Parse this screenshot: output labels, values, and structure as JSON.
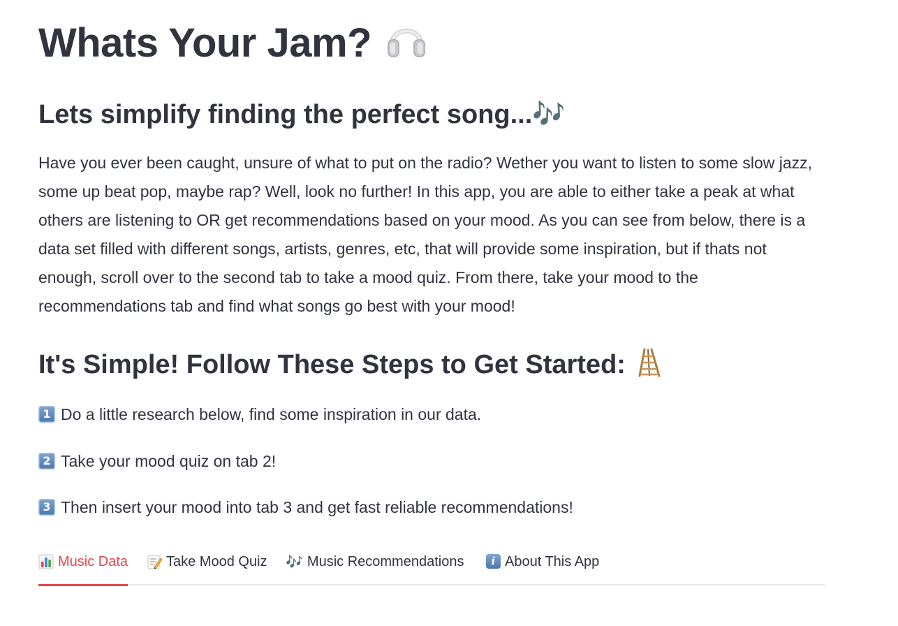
{
  "header": {
    "title": "Whats Your Jam?",
    "title_icon": "headphones-icon"
  },
  "subtitle": {
    "text": "Lets simplify finding the perfect song...",
    "icon_glyph": "🎶"
  },
  "intro": {
    "text": "Have you ever been caught, unsure of what to put on the radio? Wether you want to listen to some slow jazz, some up beat pop, maybe rap? Well, look no further! In this app, you are able to either take a peak at what others are listening to OR get recommendations based on your mood. As you can see from below, there is a data set filled with different songs, artists, genres, etc, that will provide some inspiration, but if thats not enough, scroll over to the second tab to take a mood quiz. From there, take your mood to the recommendations tab and find what songs go best with your mood!"
  },
  "steps_section": {
    "title": "It's Simple! Follow These Steps to Get Started:",
    "title_icon": "ladder-icon",
    "steps": [
      {
        "number": "1",
        "text": "Do a little research below, find some inspiration in our data."
      },
      {
        "number": "2",
        "text": "Take your mood quiz on tab 2!"
      },
      {
        "number": "3",
        "text": "Then insert your mood into tab 3 and get fast reliable recommendations!"
      }
    ]
  },
  "tabs": [
    {
      "label": "Music Data",
      "icon": "bar-chart-icon",
      "active": true
    },
    {
      "label": "Take Mood Quiz",
      "icon": "memo-icon",
      "active": false
    },
    {
      "label": "Music Recommendations",
      "icon": "music-notes-icon",
      "icon_glyph": "🎶",
      "active": false
    },
    {
      "label": "About This App",
      "icon": "info-icon",
      "icon_glyph": "i",
      "active": false
    }
  ],
  "colors": {
    "text": "#31333f",
    "accent": "#e0474c",
    "tab_baseline": "#e6e6ea",
    "keycap": "#4a77b0"
  }
}
